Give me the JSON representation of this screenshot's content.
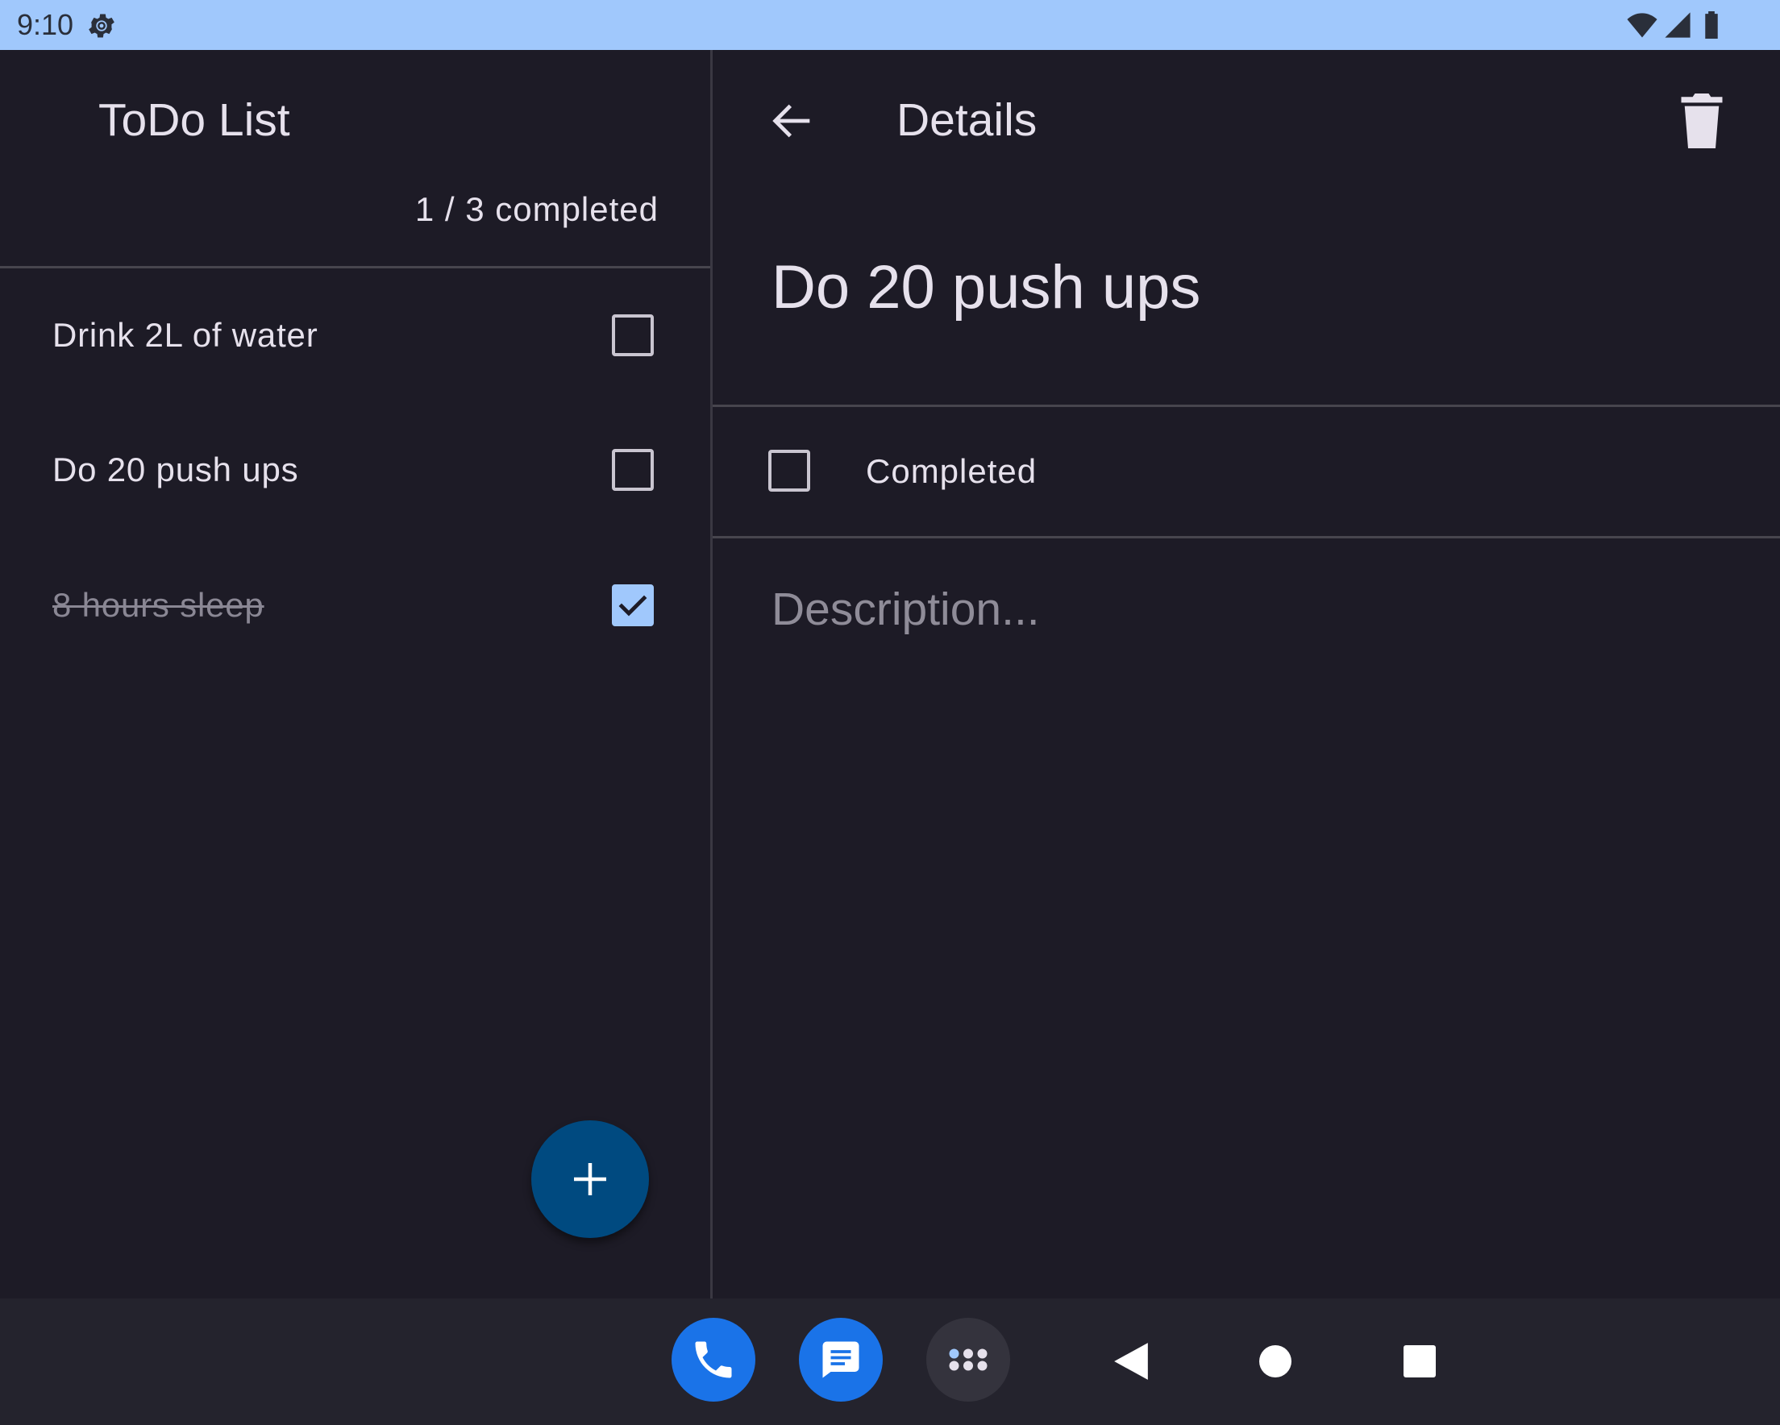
{
  "status_bar": {
    "time": "9:10",
    "icons": [
      "settings-gear-icon",
      "wifi-icon",
      "cell-signal-icon",
      "battery-icon"
    ]
  },
  "list_pane": {
    "title": "ToDo List",
    "completed_count": "1 / 3 completed",
    "items": [
      {
        "label": "Drink 2L of water",
        "checked": false
      },
      {
        "label": "Do 20 push ups",
        "checked": false
      },
      {
        "label": "8 hours sleep",
        "checked": true
      }
    ],
    "add_icon": "plus-icon"
  },
  "details_pane": {
    "title": "Details",
    "back_icon": "arrow-back-icon",
    "delete_icon": "trash-icon",
    "task_title": "Do 20 push ups",
    "completed_label": "Completed",
    "completed_checked": false,
    "description_placeholder": "Description..."
  },
  "nav_bar": {
    "dock": [
      "phone-icon",
      "messages-icon",
      "apps-grid-icon"
    ],
    "buttons": [
      "back-triangle-icon",
      "home-circle-icon",
      "recents-square-icon"
    ]
  },
  "colors": {
    "background": "#1d1b26",
    "status_bar": "#a0c8fc",
    "accent": "#a0c8fc",
    "fab": "#004a80",
    "dock_blue": "#1a73e8"
  }
}
